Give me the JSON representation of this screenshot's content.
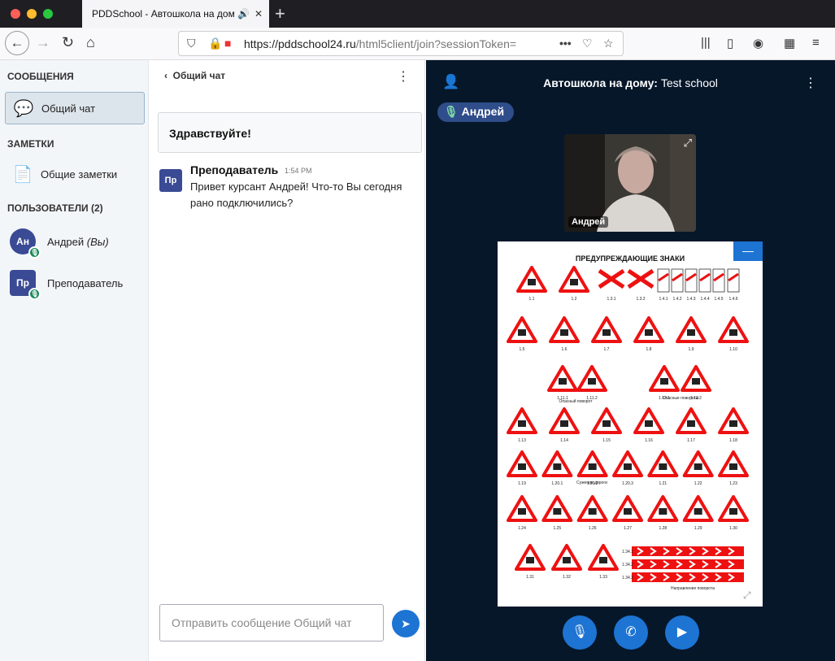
{
  "browser": {
    "tab_title": "PDDSchool - Автошкола на дом",
    "url_main": "https://pddschool24.ru",
    "url_rest": "/html5client/join?sessionToken=",
    "traffic": {
      "red": "#fe5f57",
      "yellow": "#febc2e",
      "green": "#28c840"
    }
  },
  "nav": {
    "messages_title": "СООБЩЕНИЯ",
    "public_chat": "Общий чат",
    "notes_title": "ЗАМЕТКИ",
    "shared_notes": "Общие заметки",
    "users_title": "ПОЛЬЗОВАТЕЛИ",
    "users_count": "(2)",
    "users": [
      {
        "initials": "Ан",
        "name": "Андрей",
        "suffix": "(Вы)"
      },
      {
        "initials": "Пр",
        "name": "Преподаватель"
      }
    ]
  },
  "chat": {
    "header": "Общий чат",
    "welcome": "Здравствуйте!",
    "message": {
      "avatar": "Пр",
      "author": "Преподаватель",
      "time": "1:54 PM",
      "text": "Привет курсант Андрей! Что-то Вы сегодня рано подключились?"
    },
    "input_placeholder": "Отправить сообщение Общий чат"
  },
  "presentation": {
    "title_bold": "Автошкола на дому:",
    "title_rest": "Test school",
    "talking": "Андрей",
    "video_name": "Андрей",
    "slide_title": "ПРЕДУПРЕЖДАЮЩИЕ ЗНАКИ",
    "sign_rows": [
      [
        "1.1",
        "1.2",
        "1.3.1",
        "1.3.2",
        "1.4.1",
        "1.4.2",
        "1.4.3",
        "1.4.4",
        "1.4.5",
        "1.4.6"
      ],
      [
        "1.5",
        "1.6",
        "1.7",
        "1.8",
        "1.9",
        "1.10"
      ],
      [
        "1.11.1",
        "1.11.2",
        "1.12.1",
        "1.12.2"
      ],
      [
        "1.13",
        "1.14",
        "1.15",
        "1.16",
        "1.17",
        "1.18"
      ],
      [
        "1.19",
        "1.20.1",
        "1.20.2",
        "1.20.3",
        "1.21",
        "1.22",
        "1.23"
      ],
      [
        "1.24",
        "1.25",
        "1.26",
        "1.27",
        "1.28",
        "1.29",
        "1.30"
      ],
      [
        "1.31",
        "1.32",
        "1.33",
        "1.34.1",
        "1.34.2",
        "1.34.3"
      ]
    ],
    "sign_captions": [
      "Опасный поворот",
      "Опасные повороты",
      "Сужение дороги",
      "Направление поворота"
    ]
  }
}
